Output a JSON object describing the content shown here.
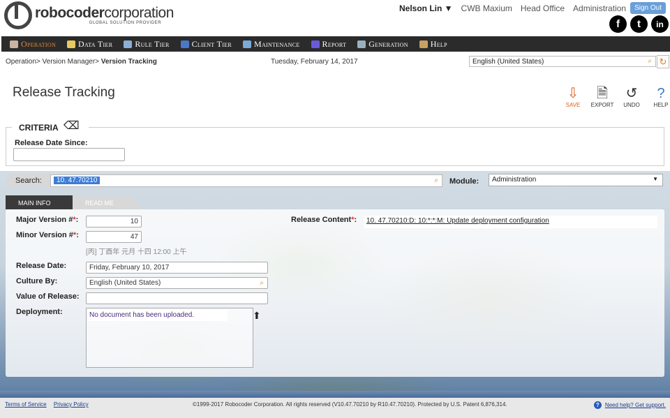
{
  "header": {
    "brand_bold": "robocoder",
    "brand_light": "corporation",
    "brand_sub": "GLOBAL SOLUTION PROVIDER",
    "user": "Nelson Lin ▼",
    "links": [
      "CWB Maxium",
      "Head Office",
      "Administration"
    ],
    "signout": "Sign Out",
    "social": [
      "f",
      "t",
      "in"
    ]
  },
  "nav": [
    {
      "label": "Operation",
      "icon_color": "#c9b4a0",
      "active": true
    },
    {
      "label": "Data Tier",
      "icon_color": "#e8c860"
    },
    {
      "label": "Rule Tier",
      "icon_color": "#8ab0d8"
    },
    {
      "label": "Client Tier",
      "icon_color": "#4a78c8"
    },
    {
      "label": "Maintenance",
      "icon_color": "#7aaad8"
    },
    {
      "label": "Report",
      "icon_color": "#6a5ad8"
    },
    {
      "label": "Generation",
      "icon_color": "#9ab0c0"
    },
    {
      "label": "Help",
      "icon_color": "#c8a060"
    }
  ],
  "breadcrumb": {
    "part1": "Operation>",
    "part2": " Version Manager>",
    "current": " Version Tracking"
  },
  "date": "Tuesday, February 14, 2017",
  "language": "English (United States)",
  "page": {
    "title": "Release Tracking",
    "toolbar": {
      "save": "SAVE",
      "export": "EXPORT",
      "undo": "UNDO",
      "help": "HELP"
    }
  },
  "criteria": {
    "title": "CRITERIA",
    "release_date_since_label": "Release Date Since:",
    "release_date_since_value": ""
  },
  "search": {
    "label": "Search:",
    "value": "10.  47.70210"
  },
  "module": {
    "label": "Module:",
    "value": "Administration"
  },
  "tabs": {
    "main": "Main Info",
    "readme": "Read Me"
  },
  "form": {
    "major_label": "Major Version #",
    "major_value": "10",
    "minor_label": "Minor Version #",
    "minor_value": "47",
    "hint": "[丙] 丁酉年 元月 十四 12:00 上午",
    "release_date_label": "Release Date:",
    "release_date_value": "Friday, February 10, 2017",
    "culture_label": "Culture By:",
    "culture_value": "English (United States)",
    "value_label": "Value of Release:",
    "value_value": "",
    "deployment_label": "Deployment:",
    "deployment_msg": "No document has been uploaded.",
    "release_content_label": "Release Content",
    "release_content_value": "10.  47.70210:D: 10:*:*:M: Update deployment configuration",
    "req": "*",
    "colon": ":"
  },
  "footer": {
    "terms": "Terms of Service",
    "privacy": "Privacy Policy",
    "copyright": "©1999-2017 Robocoder Corporation. All rights reserved (V10.47.70210 by R10.47.70210). Protected by U.S. Patent 6,876,314.",
    "help": "Need help? Get support."
  }
}
